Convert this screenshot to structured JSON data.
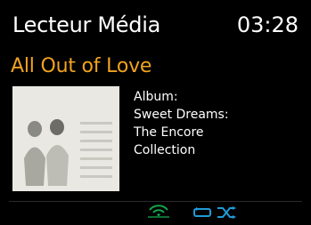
{
  "header": {
    "app_title": "Lecteur Média",
    "clock": "03:28"
  },
  "track": {
    "title": "All Out of Love"
  },
  "album_info": {
    "lines": [
      "Album:",
      "Sweet Dreams:",
      "The Encore",
      "Collection"
    ]
  },
  "status_icons": [
    "wifi-icon",
    "repeat-icon",
    "shuffle-icon"
  ],
  "colors": {
    "background": "#000000",
    "title_accent": "#f0a31e",
    "icon_green": "#14a54a",
    "icon_blue": "#1f9bd8"
  }
}
